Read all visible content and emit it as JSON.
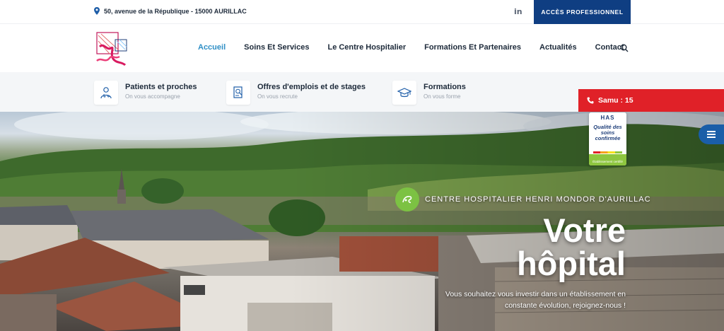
{
  "topbar": {
    "address": "50, avenue de la République - 15000 AURILLAC",
    "linkedin_label": "in",
    "pro_button": "ACCÈS PROFESSIONNEL"
  },
  "nav": {
    "items": [
      {
        "label": "Accueil",
        "active": true
      },
      {
        "label": "Soins Et Services"
      },
      {
        "label": "Le Centre Hospitalier"
      },
      {
        "label": "Formations Et Partenaires"
      },
      {
        "label": "Actualités"
      },
      {
        "label": "Contact"
      }
    ]
  },
  "quick_links": [
    {
      "title": "Patients et proches",
      "subtitle": "On vous accompagne",
      "icon": "doctor-icon"
    },
    {
      "title": "Offres d'emplois et de stages",
      "subtitle": "On vous recrute",
      "icon": "document-icon"
    },
    {
      "title": "Formations",
      "subtitle": "On vous forme",
      "icon": "graduation-cap-icon"
    }
  ],
  "samu": {
    "label": "Samu : 15"
  },
  "has_badge": {
    "logo": "HAS",
    "main": "Qualité des soins confirmée",
    "footer": "Établissement certifié"
  },
  "hero": {
    "tagline": "CENTRE HOSPITALIER HENRI MONDOR D'AURILLAC",
    "title_line1": "Votre",
    "title_line2": "hôpital",
    "subtitle": "Vous souhaitez vous investir dans un établissement en constante évolution, rejoignez-nous !"
  },
  "colors": {
    "brand_blue": "#0f3e82",
    "active_nav": "#2f8fc6",
    "samu_red": "#e02128",
    "green_accent": "#7cc243"
  }
}
